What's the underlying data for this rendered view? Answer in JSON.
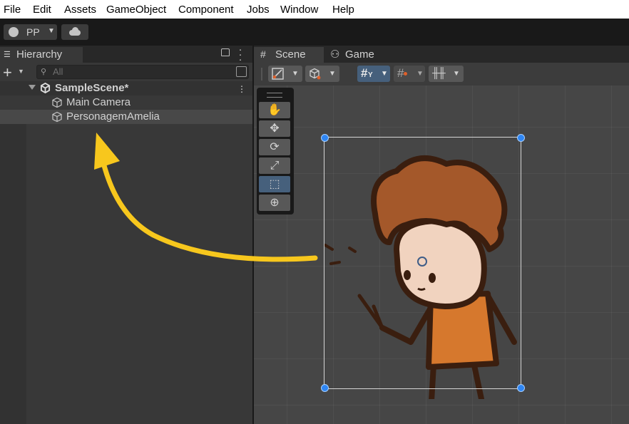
{
  "menubar": {
    "items": [
      "File",
      "Edit",
      "Assets",
      "GameObject",
      "Component",
      "Jobs",
      "Window",
      "Help"
    ]
  },
  "toolbar": {
    "account_label": "PP",
    "account_icon": "account-icon",
    "cloud_icon": "cloud-icon"
  },
  "hierarchy": {
    "tab_label": "Hierarchy",
    "search_placeholder": "All",
    "scene_name": "SampleScene*",
    "items": [
      {
        "label": "Main Camera",
        "icon": "gameobject-cube-icon",
        "selected": false
      },
      {
        "label": "PersonagemAmelia",
        "icon": "gameobject-cube-icon",
        "selected": true
      }
    ]
  },
  "scene_view": {
    "tabs": [
      {
        "label": "Scene",
        "icon": "grid-icon",
        "active": true
      },
      {
        "label": "Game",
        "icon": "gamepad-icon",
        "active": false
      }
    ],
    "tools": [
      {
        "name": "hand-tool",
        "symbol": "✋",
        "selected": false
      },
      {
        "name": "move-tool",
        "symbol": "✥",
        "selected": false
      },
      {
        "name": "rotate-tool",
        "symbol": "⟳",
        "selected": false
      },
      {
        "name": "scale-tool",
        "symbol": "⤢",
        "selected": false
      },
      {
        "name": "rect-tool",
        "symbol": "⬚",
        "selected": true
      },
      {
        "name": "transform-tool",
        "symbol": "⊕",
        "selected": false
      }
    ]
  },
  "colors": {
    "accent": "#2f86f3",
    "arrow": "#f7c71d",
    "selection": "#46607c"
  }
}
